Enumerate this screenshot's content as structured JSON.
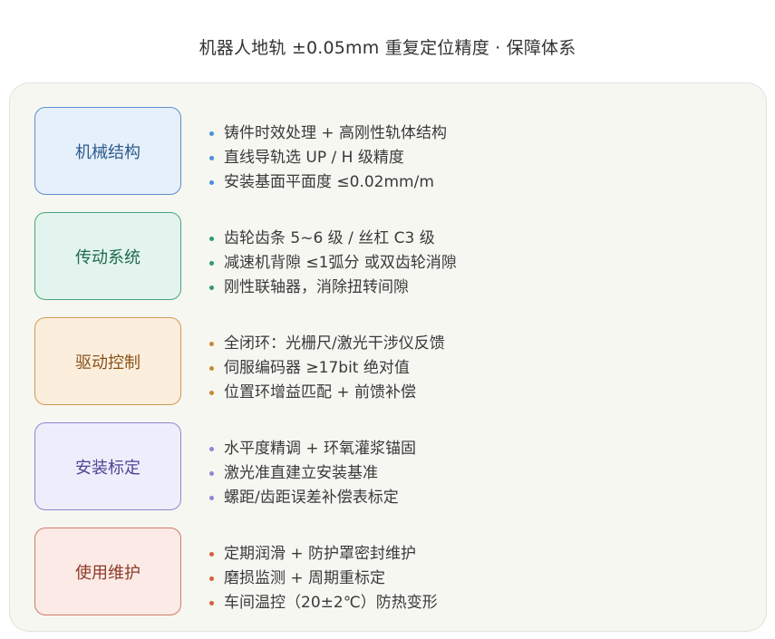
{
  "title": "机器人地轨 ±0.05mm 重复定位精度 · 保障体系",
  "categories": [
    {
      "label": "机械结构",
      "colors": {
        "fill": "#e6f0fb",
        "border": "#5b8fc9",
        "text": "#2c5a8c",
        "dot": "#4a90d9"
      },
      "items": [
        "铸件时效处理 + 高刚性轨体结构",
        "直线导轨选 UP / H 级精度",
        "安装基面平面度 ≤0.02mm/m"
      ]
    },
    {
      "label": "传动系统",
      "colors": {
        "fill": "#e3f4ee",
        "border": "#4aa37e",
        "text": "#1f6a4c",
        "dot": "#2e9b6a"
      },
      "items": [
        "齿轮齿条 5~6 级 / 丝杠 C3 级",
        "减速机背隙 ≤1弧分 或双齿轮消隙",
        "刚性联轴器，消除扭转间隙"
      ]
    },
    {
      "label": "驱动控制",
      "colors": {
        "fill": "#fbeedd",
        "border": "#d09a52",
        "text": "#8a531a",
        "dot": "#c98a32"
      },
      "items": [
        "全闭环：光栅尺/激光干涉仪反馈",
        "伺服编码器 ≥17bit 绝对值",
        "位置环增益匹配 + 前馈补偿"
      ]
    },
    {
      "label": "安装标定",
      "colors": {
        "fill": "#eeedfb",
        "border": "#8c86cf",
        "text": "#4b4595",
        "dot": "#8f86d8"
      },
      "items": [
        "水平度精调 + 环氧灌浆锚固",
        "激光准直建立安装基准",
        "螺距/齿距误差补偿表标定"
      ]
    },
    {
      "label": "使用维护",
      "colors": {
        "fill": "#fbeae6",
        "border": "#d27a66",
        "text": "#8c3a26",
        "dot": "#d5603f"
      },
      "items": [
        "定期润滑 + 防护罩密封维护",
        "磨损监测 + 周期重标定",
        "车间温控（20±2℃）防热变形"
      ]
    }
  ]
}
